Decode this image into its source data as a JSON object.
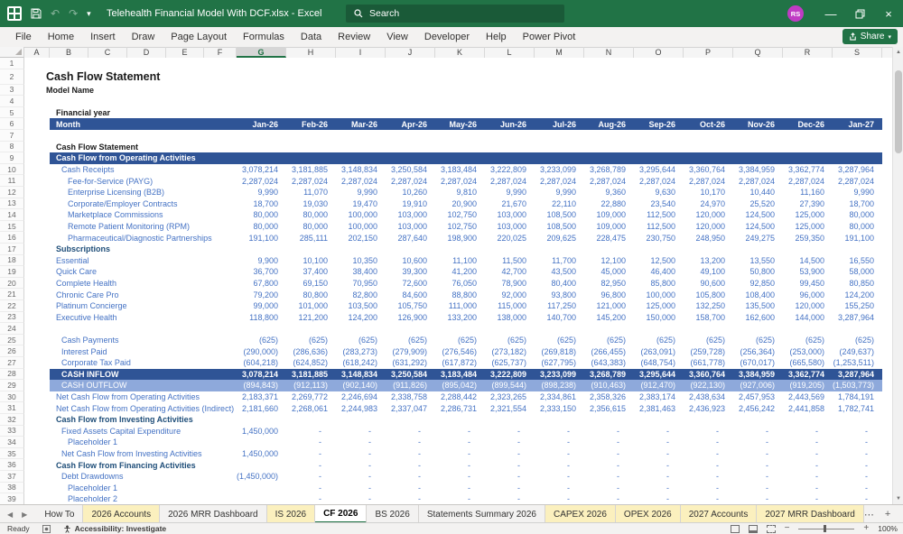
{
  "titlebar": {
    "title": "Telehealth Financial Model With DCF.xlsx - Excel",
    "search_placeholder": "Search",
    "avatar_initials": "RS"
  },
  "ribbon": {
    "tabs": [
      "File",
      "Home",
      "Insert",
      "Draw",
      "Page Layout",
      "Formulas",
      "Data",
      "Review",
      "View",
      "Developer",
      "Help",
      "Power Pivot"
    ],
    "share_label": "Share"
  },
  "grid": {
    "columns": [
      "A",
      "B",
      "C",
      "D",
      "E",
      "F",
      "G",
      "H",
      "I",
      "J",
      "K",
      "L",
      "M",
      "N",
      "O",
      "P",
      "Q",
      "R",
      "S"
    ],
    "selected_column": "G"
  },
  "sheet": {
    "months": [
      "Jan-26",
      "Feb-26",
      "Mar-26",
      "Apr-26",
      "May-26",
      "Jun-26",
      "Jul-26",
      "Aug-26",
      "Sep-26",
      "Oct-26",
      "Nov-26",
      "Dec-26",
      "Jan-27"
    ],
    "rows": [
      {
        "n": 2,
        "label": "Cash Flow Statement",
        "style": "title",
        "indent": 0,
        "values": null
      },
      {
        "n": 3,
        "label": "Model Name",
        "style": "bold",
        "indent": 0,
        "values": null
      },
      {
        "n": 5,
        "label": "Financial year",
        "style": "bold",
        "indent": 1,
        "values": null
      },
      {
        "n": 6,
        "label": "Month",
        "style": "band",
        "indent": 1,
        "values": [
          "Jan-26",
          "Feb-26",
          "Mar-26",
          "Apr-26",
          "May-26",
          "Jun-26",
          "Jul-26",
          "Aug-26",
          "Sep-26",
          "Oct-26",
          "Nov-26",
          "Dec-26",
          "Jan-27"
        ]
      },
      {
        "n": 8,
        "label": "Cash Flow Statement",
        "style": "bold",
        "indent": 1,
        "values": null
      },
      {
        "n": 9,
        "label": "Cash Flow from Operating Activities",
        "style": "band",
        "indent": 1,
        "values": null
      },
      {
        "n": 10,
        "label": "Cash Receipts",
        "style": "item",
        "indent": 2,
        "values": [
          "3,078,214",
          "3,181,885",
          "3,148,834",
          "3,250,584",
          "3,183,484",
          "3,222,809",
          "3,233,099",
          "3,268,789",
          "3,295,644",
          "3,360,764",
          "3,384,959",
          "3,362,774",
          "3,287,964"
        ]
      },
      {
        "n": 11,
        "label": "Fee-for-Service (PAYG)",
        "style": "item",
        "indent": 3,
        "values": [
          "2,287,024",
          "2,287,024",
          "2,287,024",
          "2,287,024",
          "2,287,024",
          "2,287,024",
          "2,287,024",
          "2,287,024",
          "2,287,024",
          "2,287,024",
          "2,287,024",
          "2,287,024",
          "2,287,024"
        ]
      },
      {
        "n": 12,
        "label": "Enterprise Licensing (B2B)",
        "style": "item",
        "indent": 3,
        "values": [
          "9,990",
          "11,070",
          "9,990",
          "10,260",
          "9,810",
          "9,990",
          "9,990",
          "9,360",
          "9,630",
          "10,170",
          "10,440",
          "11,160",
          "9,990"
        ]
      },
      {
        "n": 13,
        "label": "Corporate/Employer Contracts",
        "style": "item",
        "indent": 3,
        "values": [
          "18,700",
          "19,030",
          "19,470",
          "19,910",
          "20,900",
          "21,670",
          "22,110",
          "22,880",
          "23,540",
          "24,970",
          "25,520",
          "27,390",
          "18,700"
        ]
      },
      {
        "n": 14,
        "label": "Marketplace Commissions",
        "style": "item",
        "indent": 3,
        "values": [
          "80,000",
          "80,000",
          "100,000",
          "103,000",
          "102,750",
          "103,000",
          "108,500",
          "109,000",
          "112,500",
          "120,000",
          "124,500",
          "125,000",
          "80,000"
        ]
      },
      {
        "n": 15,
        "label": "Remote Patient Monitoring (RPM)",
        "style": "item",
        "indent": 3,
        "values": [
          "80,000",
          "80,000",
          "100,000",
          "103,000",
          "102,750",
          "103,000",
          "108,500",
          "109,000",
          "112,500",
          "120,000",
          "124,500",
          "125,000",
          "80,000"
        ]
      },
      {
        "n": 16,
        "label": "Pharmaceutical/Diagnostic Partnerships",
        "style": "item",
        "indent": 3,
        "values": [
          "191,100",
          "285,111",
          "202,150",
          "287,640",
          "198,900",
          "220,025",
          "209,625",
          "228,475",
          "230,750",
          "248,950",
          "249,275",
          "259,350",
          "191,100"
        ]
      },
      {
        "n": 17,
        "label": "Subscriptions",
        "style": "navy",
        "indent": 1,
        "values": null
      },
      {
        "n": 18,
        "label": "Essential",
        "style": "item",
        "indent": 1,
        "values": [
          "9,900",
          "10,100",
          "10,350",
          "10,600",
          "11,100",
          "11,500",
          "11,700",
          "12,100",
          "12,500",
          "13,200",
          "13,550",
          "14,500",
          "16,550"
        ]
      },
      {
        "n": 19,
        "label": "Quick Care",
        "style": "item",
        "indent": 1,
        "values": [
          "36,700",
          "37,400",
          "38,400",
          "39,300",
          "41,200",
          "42,700",
          "43,500",
          "45,000",
          "46,400",
          "49,100",
          "50,800",
          "53,900",
          "58,000"
        ]
      },
      {
        "n": 20,
        "label": "Complete Health",
        "style": "item",
        "indent": 1,
        "values": [
          "67,800",
          "69,150",
          "70,950",
          "72,600",
          "76,050",
          "78,900",
          "80,400",
          "82,950",
          "85,800",
          "90,600",
          "92,850",
          "99,450",
          "80,850"
        ]
      },
      {
        "n": 21,
        "label": "Chronic Care Pro",
        "style": "item",
        "indent": 1,
        "values": [
          "79,200",
          "80,800",
          "82,800",
          "84,600",
          "88,800",
          "92,000",
          "93,800",
          "96,800",
          "100,000",
          "105,800",
          "108,400",
          "96,000",
          "124,200"
        ]
      },
      {
        "n": 22,
        "label": "Platinum Concierge",
        "style": "item",
        "indent": 1,
        "values": [
          "99,000",
          "101,000",
          "103,500",
          "105,750",
          "111,000",
          "115,000",
          "117,250",
          "121,000",
          "125,000",
          "132,250",
          "135,500",
          "120,000",
          "155,250"
        ]
      },
      {
        "n": 23,
        "label": "Executive Health",
        "style": "item",
        "indent": 1,
        "values": [
          "118,800",
          "121,200",
          "124,200",
          "126,900",
          "133,200",
          "138,000",
          "140,700",
          "145,200",
          "150,000",
          "158,700",
          "162,600",
          "144,000",
          "3,287,964"
        ]
      },
      {
        "n": 25,
        "label": "Cash Payments",
        "style": "item",
        "indent": 2,
        "values": [
          "(625)",
          "(625)",
          "(625)",
          "(625)",
          "(625)",
          "(625)",
          "(625)",
          "(625)",
          "(625)",
          "(625)",
          "(625)",
          "(625)",
          "(625)"
        ]
      },
      {
        "n": 26,
        "label": "Interest Paid",
        "style": "item",
        "indent": 2,
        "values": [
          "(290,000)",
          "(286,636)",
          "(283,273)",
          "(279,909)",
          "(276,546)",
          "(273,182)",
          "(269,818)",
          "(266,455)",
          "(263,091)",
          "(259,728)",
          "(256,364)",
          "(253,000)",
          "(249,637)"
        ]
      },
      {
        "n": 27,
        "label": "Corporate Tax Paid",
        "style": "item",
        "indent": 2,
        "values": [
          "(604,218)",
          "(624,852)",
          "(618,242)",
          "(631,292)",
          "(617,872)",
          "(625,737)",
          "(627,795)",
          "(643,383)",
          "(648,754)",
          "(661,778)",
          "(670,017)",
          "(665,580)",
          "(1,253,511)"
        ]
      },
      {
        "n": 28,
        "label": "CASH INFLOW",
        "style": "cashin",
        "indent": 2,
        "values": [
          "3,078,214",
          "3,181,885",
          "3,148,834",
          "3,250,584",
          "3,183,484",
          "3,222,809",
          "3,233,099",
          "3,268,789",
          "3,295,644",
          "3,360,764",
          "3,384,959",
          "3,362,774",
          "3,287,964"
        ]
      },
      {
        "n": 29,
        "label": "CASH OUTFLOW",
        "style": "cashout",
        "indent": 2,
        "values": [
          "(894,843)",
          "(912,113)",
          "(902,140)",
          "(911,826)",
          "(895,042)",
          "(899,544)",
          "(898,238)",
          "(910,463)",
          "(912,470)",
          "(922,130)",
          "(927,006)",
          "(919,205)",
          "(1,503,773)"
        ]
      },
      {
        "n": 30,
        "label": "Net Cash Flow from Operating Activities",
        "style": "item",
        "indent": 1,
        "values": [
          "2,183,371",
          "2,269,772",
          "2,246,694",
          "2,338,758",
          "2,288,442",
          "2,323,265",
          "2,334,861",
          "2,358,326",
          "2,383,174",
          "2,438,634",
          "2,457,953",
          "2,443,569",
          "1,784,191"
        ]
      },
      {
        "n": 31,
        "label": "Net Cash Flow from Operating Activities (Indirect)",
        "style": "item",
        "indent": 1,
        "values": [
          "2,181,660",
          "2,268,061",
          "2,244,983",
          "2,337,047",
          "2,286,731",
          "2,321,554",
          "2,333,150",
          "2,356,615",
          "2,381,463",
          "2,436,923",
          "2,456,242",
          "2,441,858",
          "1,782,741"
        ]
      },
      {
        "n": 32,
        "label": "Cash Flow from Investing Activities",
        "style": "navy",
        "indent": 1,
        "values": null
      },
      {
        "n": 33,
        "label": "Fixed Assets Capital Expenditure",
        "style": "item",
        "indent": 2,
        "values": [
          "1,450,000",
          "-",
          "-",
          "-",
          "-",
          "-",
          "-",
          "-",
          "-",
          "-",
          "-",
          "-",
          "-"
        ]
      },
      {
        "n": 34,
        "label": "Placeholder 1",
        "style": "item",
        "indent": 3,
        "values": [
          "",
          "-",
          "-",
          "-",
          "-",
          "-",
          "-",
          "-",
          "-",
          "-",
          "-",
          "-",
          "-"
        ]
      },
      {
        "n": 35,
        "label": "Net Cash Flow from Investing Activities",
        "style": "item",
        "indent": 2,
        "values": [
          "1,450,000",
          "-",
          "-",
          "-",
          "-",
          "-",
          "-",
          "-",
          "-",
          "-",
          "-",
          "-",
          "-"
        ]
      },
      {
        "n": 36,
        "label": "Cash Flow from Financing Activities",
        "style": "navy",
        "indent": 1,
        "values": [
          "",
          "-",
          "-",
          "-",
          "-",
          "-",
          "-",
          "-",
          "-",
          "-",
          "-",
          "-",
          "-"
        ]
      },
      {
        "n": 37,
        "label": "Debt Drawdowns",
        "style": "item",
        "indent": 2,
        "values": [
          "(1,450,000)",
          "-",
          "-",
          "-",
          "-",
          "-",
          "-",
          "-",
          "-",
          "-",
          "-",
          "-",
          "-"
        ]
      },
      {
        "n": 38,
        "label": "Placeholder 1",
        "style": "item",
        "indent": 3,
        "values": [
          "",
          "-",
          "-",
          "-",
          "-",
          "-",
          "-",
          "-",
          "-",
          "-",
          "-",
          "-",
          "-"
        ]
      },
      {
        "n": 39,
        "label": "Placeholder 2",
        "style": "item",
        "indent": 3,
        "values": [
          "",
          "-",
          "-",
          "-",
          "-",
          "-",
          "-",
          "-",
          "-",
          "-",
          "-",
          "-",
          "-"
        ]
      }
    ]
  },
  "tabs": {
    "items": [
      {
        "label": "How To",
        "style": "plain"
      },
      {
        "label": "2026 Accounts",
        "style": "yellow"
      },
      {
        "label": "2026 MRR Dashboard",
        "style": "plain"
      },
      {
        "label": "IS 2026",
        "style": "yellow"
      },
      {
        "label": "CF 2026",
        "style": "active"
      },
      {
        "label": "BS 2026",
        "style": "plain"
      },
      {
        "label": "Statements Summary 2026",
        "style": "plain"
      },
      {
        "label": "CAPEX 2026",
        "style": "yellow"
      },
      {
        "label": "OPEX 2026",
        "style": "yellow"
      },
      {
        "label": "2027 Accounts",
        "style": "yellow"
      },
      {
        "label": "2027 MRR Dashboard",
        "style": "yellow"
      }
    ],
    "active": "CF 2026"
  },
  "statusbar": {
    "ready": "Ready",
    "accessibility": "Accessibility: Investigate",
    "zoom": "100%"
  },
  "colors": {
    "titlebar_green": "#217346",
    "band_blue": "#2f5496",
    "band_light_blue": "#8ea9db",
    "cell_text_blue": "#4472c4",
    "section_navy": "#1f4e79",
    "tab_yellow": "#fbf0be",
    "avatar_magenta": "#c03bc4"
  }
}
